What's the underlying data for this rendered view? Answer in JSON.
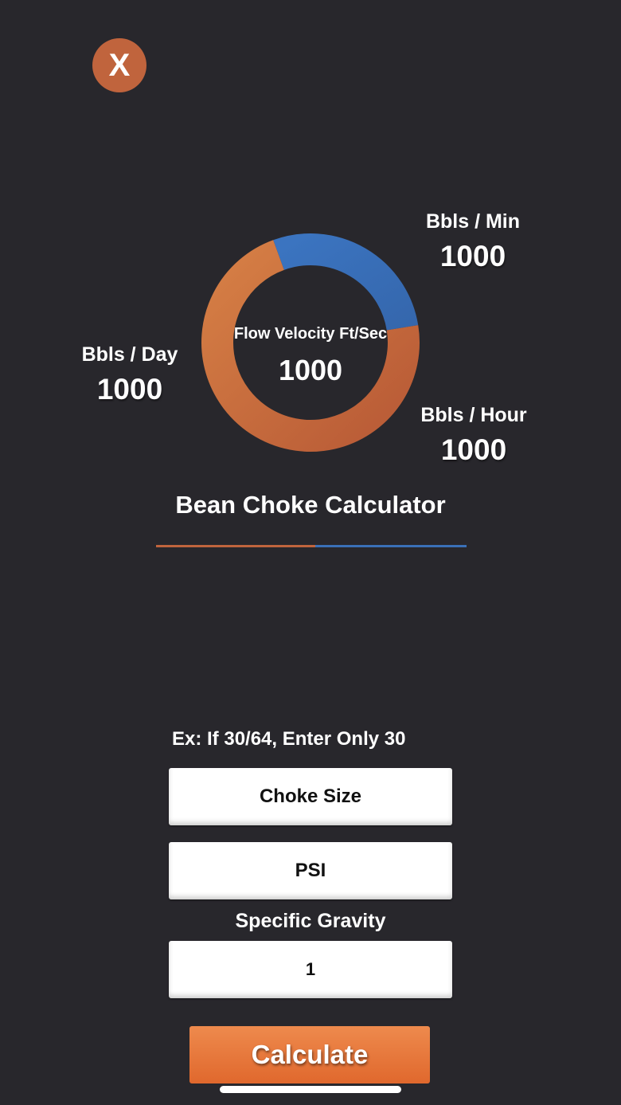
{
  "close_button": {
    "label": "X"
  },
  "gauge": {
    "center_label": "Flow Velocity Ft/Sec",
    "center_value": "1000",
    "segments": [
      {
        "name": "orange",
        "color": "#c8683d",
        "fraction": 0.72
      },
      {
        "name": "blue",
        "color": "#3a70b8",
        "fraction": 0.28
      }
    ]
  },
  "stats": {
    "per_min": {
      "label": "Bbls / Min",
      "value": "1000"
    },
    "per_day": {
      "label": "Bbls / Day",
      "value": "1000"
    },
    "per_hour": {
      "label": "Bbls / Hour",
      "value": "1000"
    }
  },
  "title": "Bean Choke Calculator",
  "form": {
    "hint": "Ex: If 30/64, Enter Only 30",
    "choke_size_placeholder": "Choke Size",
    "psi_placeholder": "PSI",
    "specific_gravity_label": "Specific Gravity",
    "specific_gravity_value": "1",
    "calculate_label": "Calculate"
  },
  "colors": {
    "background": "#28272c",
    "accent_orange": "#c0643d",
    "accent_blue": "#3a70b8",
    "button": "#e67638"
  }
}
